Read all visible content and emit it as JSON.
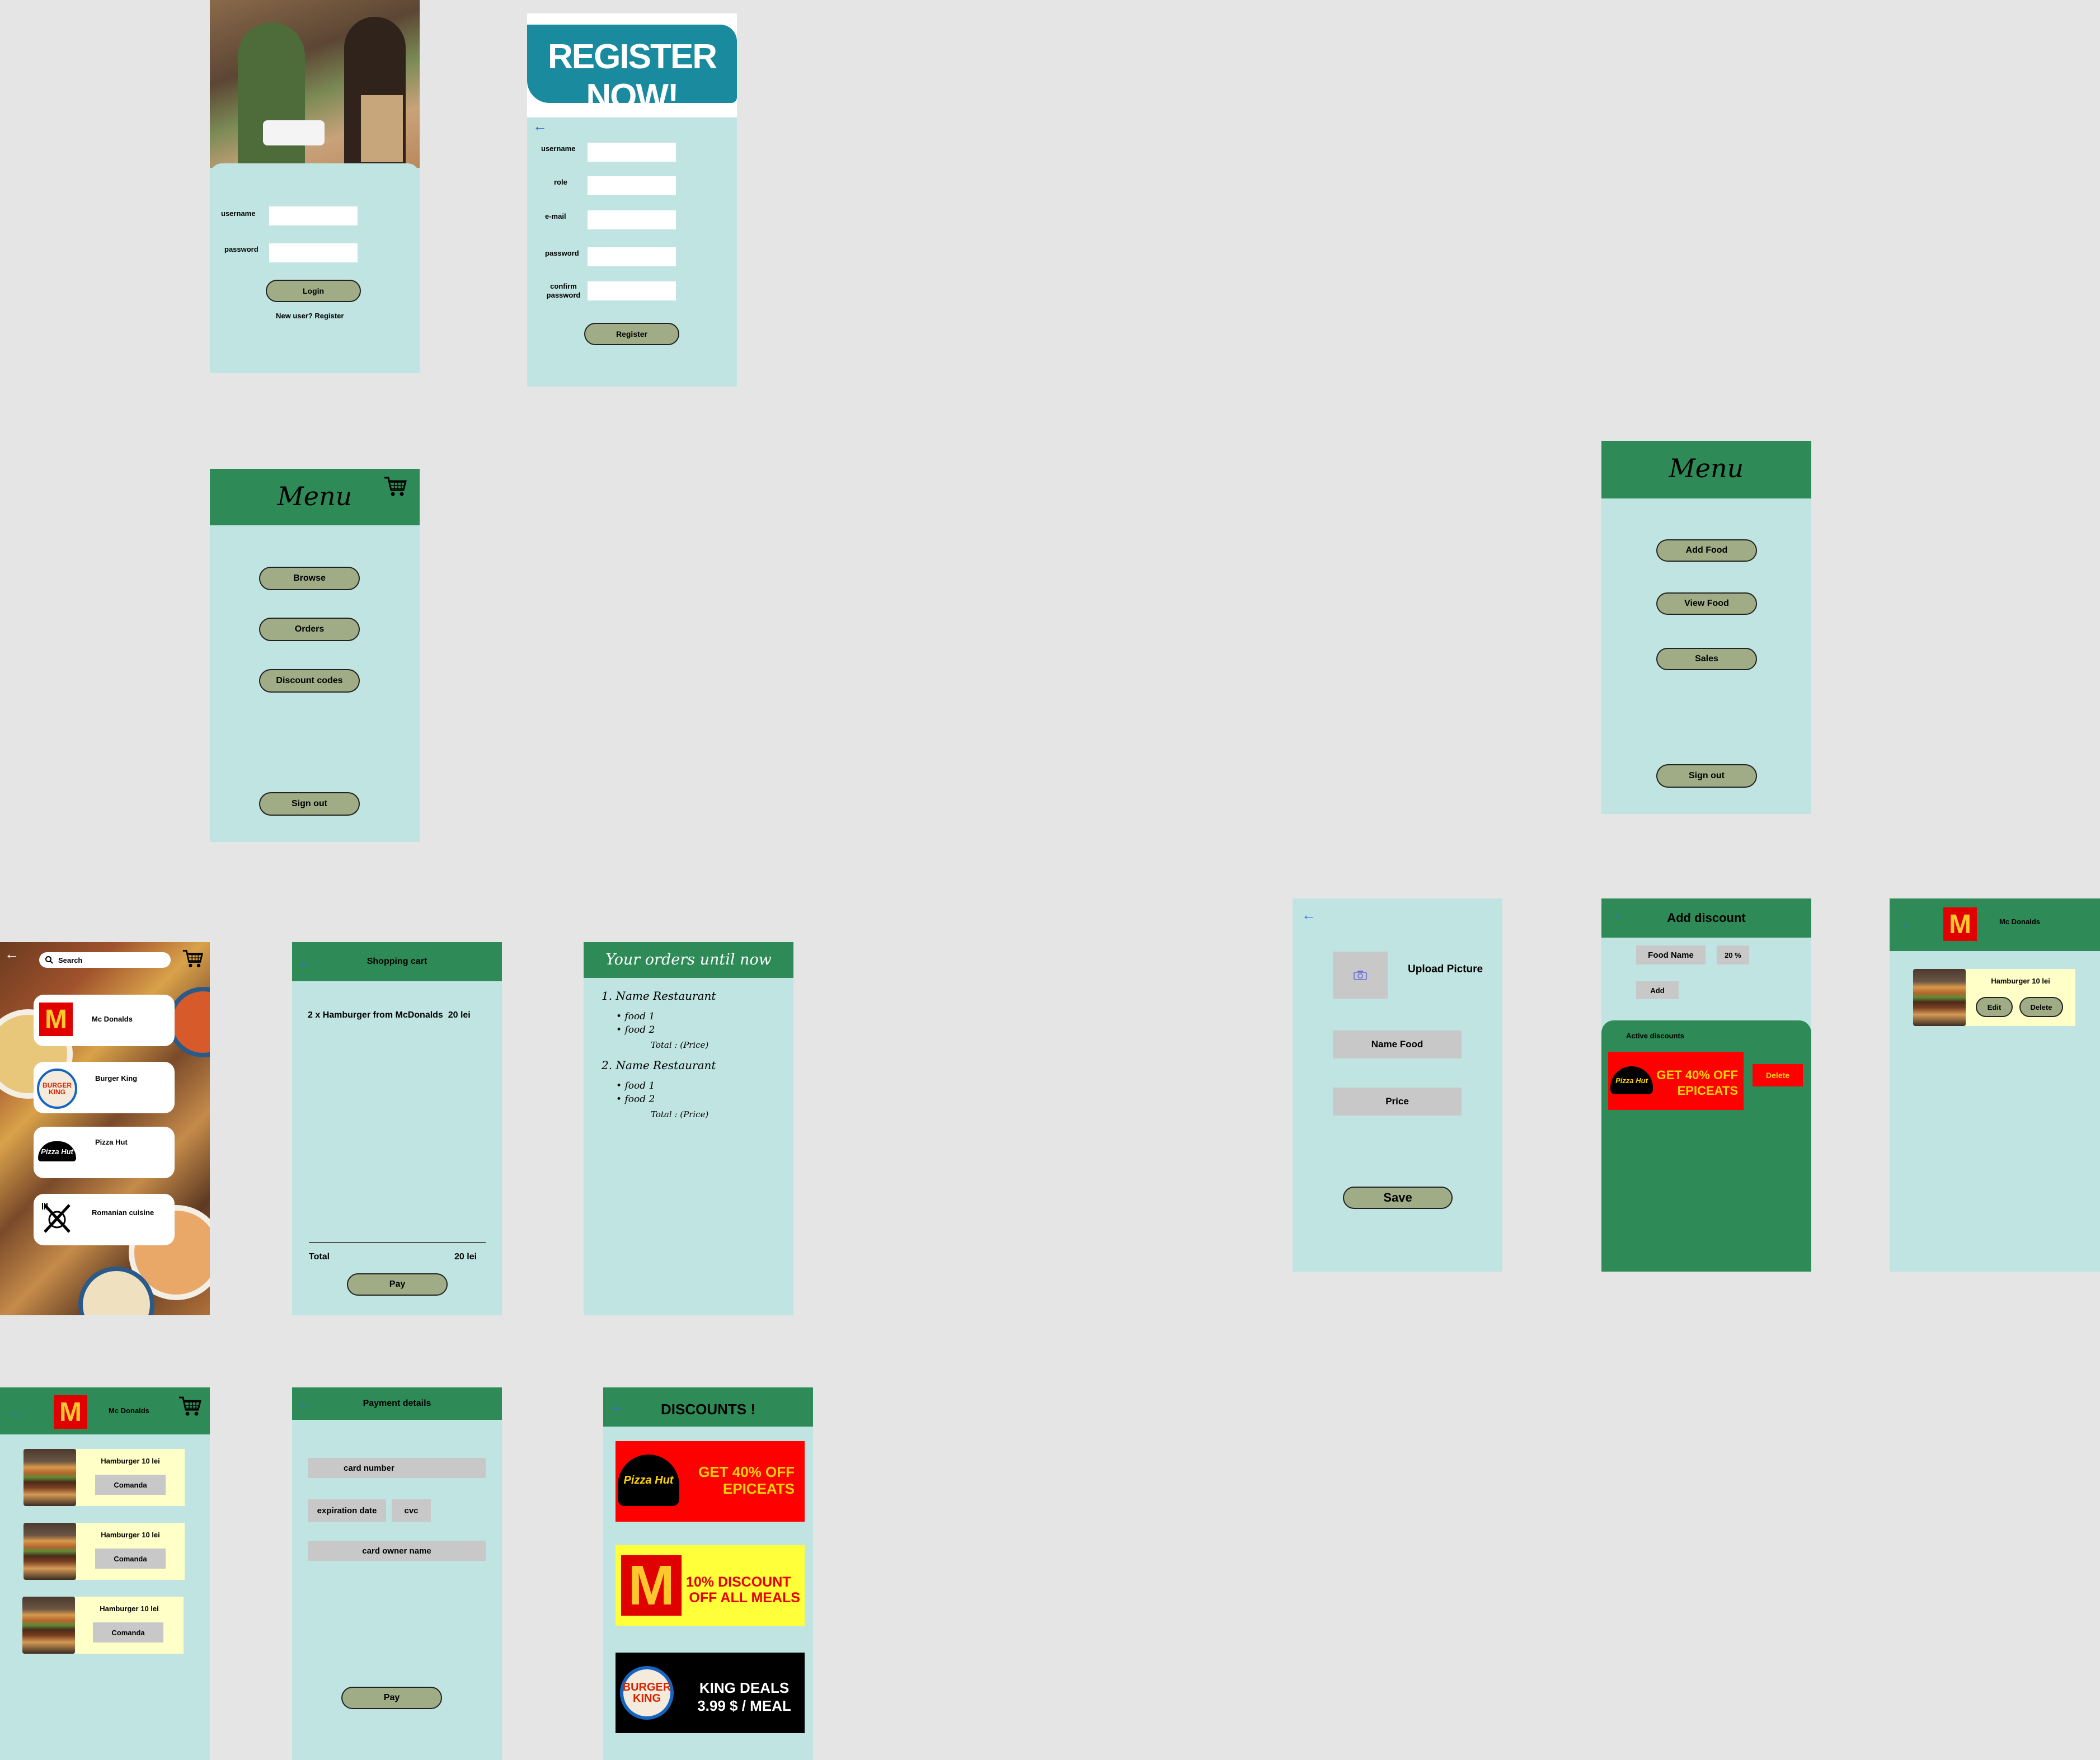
{
  "login": {
    "username_label": "username",
    "password_label": "password",
    "login_button": "Login",
    "register_link": "New user? Register"
  },
  "register": {
    "banner": "REGISTER NOW!",
    "back": "←",
    "fields": [
      "username",
      "role",
      "e-mail",
      "password",
      "confirm password"
    ],
    "register_button": "Register"
  },
  "user_menu": {
    "title": "Menu",
    "buttons": [
      "Browse",
      "Orders",
      "Discount codes"
    ],
    "sign_out": "Sign out"
  },
  "admin_menu": {
    "title": "Menu",
    "buttons": [
      "Add Food",
      "View Food",
      "Sales"
    ],
    "sign_out": "Sign out"
  },
  "browse": {
    "back": "←",
    "search_placeholder": "Search",
    "restaurants": [
      "Mc Donalds",
      "Burger King",
      "Pizza Hut",
      "Romanian cuisine"
    ]
  },
  "cart": {
    "back": "←",
    "title": "Shopping cart",
    "line_item": "2 x Hamburger from McDonalds  20 lei",
    "total_label": "Total",
    "total_value": "20 lei",
    "pay_button": "Pay"
  },
  "orders": {
    "title": "Your orders until now",
    "list": [
      {
        "name": "1. Name Restaurant",
        "items": [
          "food 1",
          "food 2"
        ],
        "total": "Total : (Price)"
      },
      {
        "name": "2. Name Restaurant",
        "items": [
          "food 1",
          "food 2"
        ],
        "total": "Total : (Price)"
      }
    ]
  },
  "add_food": {
    "back": "←",
    "upload_label": "Upload Picture",
    "name_field": "Name Food",
    "price_field": "Price",
    "save_button": "Save"
  },
  "add_discount": {
    "back": "←",
    "title": "Add discount",
    "food_name": "Food Name",
    "percent": "20 %",
    "add_button": "Add",
    "active_label": "Active discounts",
    "active_text": "GET 40% OFF EPICEATS",
    "delete_button": "Delete"
  },
  "view_food": {
    "back": "←",
    "restaurant": "Mc Donalds",
    "item": "Hamburger 10 lei",
    "edit_button": "Edit",
    "delete_button": "Delete"
  },
  "restaurant_page": {
    "back": "←",
    "restaurant": "Mc Donalds",
    "items": [
      {
        "label": "Hamburger 10 lei",
        "button": "Comanda"
      },
      {
        "label": "Hamburger 10 lei",
        "button": "Comanda"
      },
      {
        "label": "Hamburger 10 lei",
        "button": "Comanda"
      }
    ]
  },
  "payment": {
    "back": "←",
    "title": "Payment details",
    "card_number": "card number",
    "expiration": "expiration date",
    "cvc": "cvc",
    "owner": "card owner name",
    "pay_button": "Pay"
  },
  "discounts": {
    "back": "←",
    "title": "DISCOUNTS !",
    "banners": [
      {
        "text1": "GET 40% OFF",
        "text2": "EPICEATS",
        "logo_text": "Pizza Hut",
        "bg": "#ff0000",
        "fg": "#ffd400"
      },
      {
        "text1": "10% DISCOUNT",
        "text2": "OFF ALL MEALS",
        "logo_text": "M",
        "bg": "#ffff3a",
        "fg": "#e60000"
      },
      {
        "text1": "KING DEALS",
        "text2": "3.99 $ / MEAL",
        "logo_text": "BURGER KING",
        "bg": "#000000",
        "fg": "#ffffff"
      }
    ]
  },
  "colors": {
    "screen_bg": "#bfe4e2",
    "header_green": "#2e8b57",
    "pill_button": "#9fac85",
    "canvas": "#e5e5e5"
  }
}
